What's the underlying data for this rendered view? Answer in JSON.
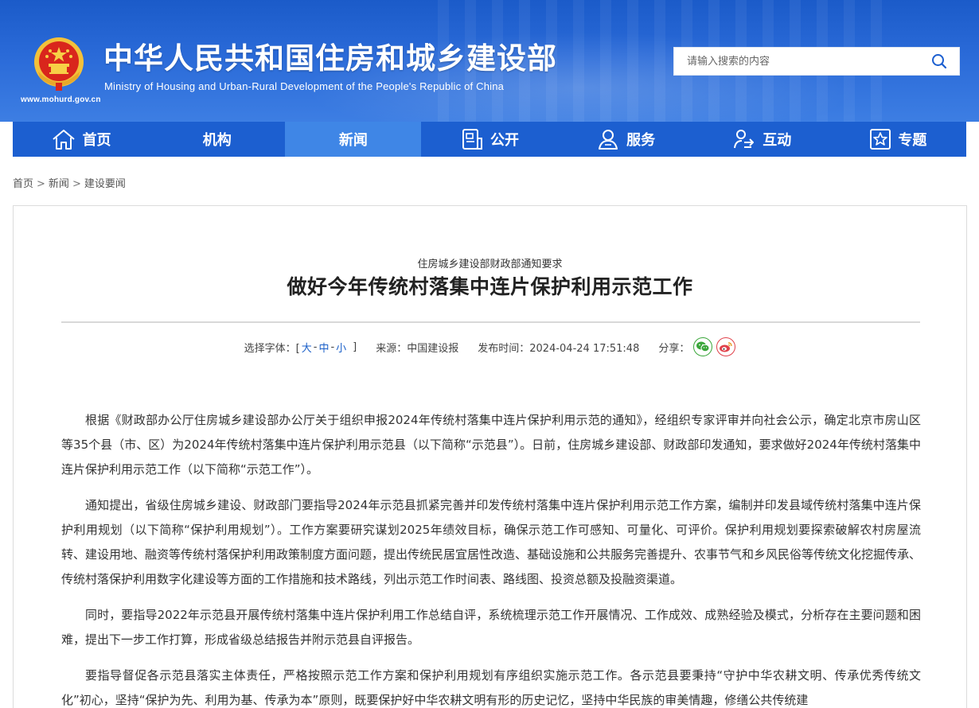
{
  "header": {
    "title": "中华人民共和国住房和城乡建设部",
    "subtitle": "Ministry of Housing and Urban-Rural Development of the People's Republic of China",
    "url": "www.mohurd.gov.cn",
    "search_placeholder": "请输入搜索的内容"
  },
  "nav": {
    "items": [
      {
        "label": "首页",
        "icon": "home-icon"
      },
      {
        "label": "机构",
        "icon": ""
      },
      {
        "label": "新闻",
        "icon": "",
        "active": true
      },
      {
        "label": "公开",
        "icon": "document-icon"
      },
      {
        "label": "服务",
        "icon": "user-service-icon"
      },
      {
        "label": "互动",
        "icon": "interaction-icon"
      },
      {
        "label": "专题",
        "icon": "star-icon"
      }
    ]
  },
  "breadcrumb": [
    "首页",
    "新闻",
    "建设要闻"
  ],
  "article": {
    "kicker": "住房城乡建设部财政部通知要求",
    "title": "做好今年传统村落集中连片保护利用示范工作",
    "font_select_label": "选择字体：[",
    "font_sizes": [
      "大",
      "中",
      "小"
    ],
    "font_select_end": "]",
    "source": "来源：中国建设报",
    "published": "发布时间：2024-04-24 17:51:48",
    "share_label": "分享：",
    "paragraphs": [
      "根据《财政部办公厅住房城乡建设部办公厅关于组织申报2024年传统村落集中连片保护利用示范的通知》，经组织专家评审并向社会公示，确定北京市房山区等35个县（市、区）为2024年传统村落集中连片保护利用示范县（以下简称“示范县”）。日前，住房城乡建设部、财政部印发通知，要求做好2024年传统村落集中连片保护利用示范工作（以下简称“示范工作”）。",
      "通知提出，省级住房城乡建设、财政部门要指导2024年示范县抓紧完善并印发传统村落集中连片保护利用示范工作方案，编制并印发县域传统村落集中连片保护利用规划（以下简称“保护利用规划”）。工作方案要研究谋划2025年绩效目标，确保示范工作可感知、可量化、可评价。保护利用规划要探索破解农村房屋流转、建设用地、融资等传统村落保护利用政策制度方面问题，提出传统民居宜居性改造、基础设施和公共服务完善提升、农事节气和乡风民俗等传统文化挖掘传承、传统村落保护利用数字化建设等方面的工作措施和技术路线，列出示范工作时间表、路线图、投资总额及投融资渠道。",
      "同时，要指导2022年示范县开展传统村落集中连片保护利用工作总结自评，系统梳理示范工作开展情况、工作成效、成熟经验及模式，分析存在主要问题和困难，提出下一步工作打算，形成省级总结报告并附示范县自评报告。",
      "要指导督促各示范县落实主体责任，严格按照示范工作方案和保护利用规划有序组织实施示范工作。各示范县要秉持“守护中华农耕文明、传承优秀传统文化”初心，坚持“保护为先、利用为基、传承为本”原则，既要保护好中华农耕文明有形的历史记忆，坚持中华民族的审美情趣，修缮公共传统建"
    ]
  },
  "colors": {
    "banner": "#1b5bc9",
    "nav": "#1c5fd0",
    "nav_active": "#3f86e6",
    "link": "#1a5fc8"
  }
}
